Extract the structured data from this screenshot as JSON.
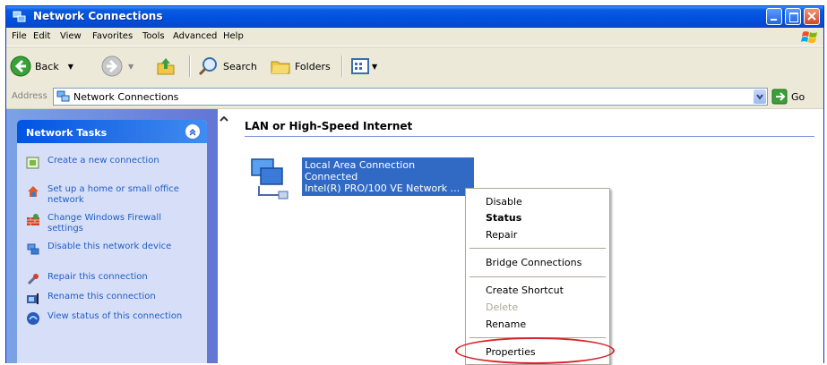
{
  "window": {
    "title": "Network Connections"
  },
  "menu": [
    "File",
    "Edit",
    "View",
    "Favorites",
    "Tools",
    "Advanced",
    "Help"
  ],
  "toolbar": {
    "back": "Back",
    "search": "Search",
    "folders": "Folders"
  },
  "address": {
    "label": "Address",
    "value": "Network Connections",
    "go": "Go"
  },
  "network_tasks": {
    "title": "Network Tasks",
    "items": [
      "Create a new connection",
      "Set up a home or small office network",
      "Change Windows Firewall settings",
      "Disable this network device",
      "Repair this connection",
      "Rename this connection",
      "View status of this connection"
    ]
  },
  "group": {
    "title": "LAN or High-Speed Internet"
  },
  "connection": {
    "name": "Local Area Connection",
    "status": "Connected",
    "device": "Intel(R) PRO/100 VE Network ..."
  },
  "context_menu": {
    "disable": "Disable",
    "status": "Status",
    "repair": "Repair",
    "bridge": "Bridge Connections",
    "shortcut": "Create Shortcut",
    "delete": "Delete",
    "rename": "Rename",
    "properties": "Properties"
  },
  "colors": {
    "title_bar": "#0a5be0",
    "selection": "#316ac5",
    "task_link": "#215dc6",
    "highlight_ring": "#d9242c"
  }
}
